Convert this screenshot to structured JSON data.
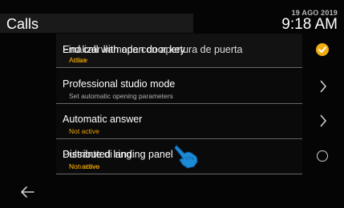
{
  "header": {
    "title": "Calls",
    "date": "19 AGO 2019",
    "time": "9:18 AM"
  },
  "rows": [
    {
      "label_a": "End call with open door key",
      "label_b": "Finalizar llamada con apertura de puerta",
      "sub_a": "Active",
      "sub_b": "Attivo",
      "control": "check-icon",
      "selected": true
    },
    {
      "label": "Professional studio mode",
      "sub": "Set automatic opening parameters",
      "control": "chevron-right-icon"
    },
    {
      "label": "Automatic answer",
      "sub": "Not active",
      "control": "chevron-right-icon"
    },
    {
      "label_a": "Distributed landing panel",
      "label_b": "Pulsante di ring",
      "sub_a": "Not active",
      "sub_b": "Non attivo",
      "control": "radio-icon",
      "selected": false
    }
  ],
  "nav": {
    "back_icon": "arrow-left-icon"
  },
  "overlay": {
    "hand_icon": "pointing-hand-icon"
  },
  "colors": {
    "accent": "#f2ae11",
    "background": "#050505",
    "divider": "#6a6a6a"
  }
}
